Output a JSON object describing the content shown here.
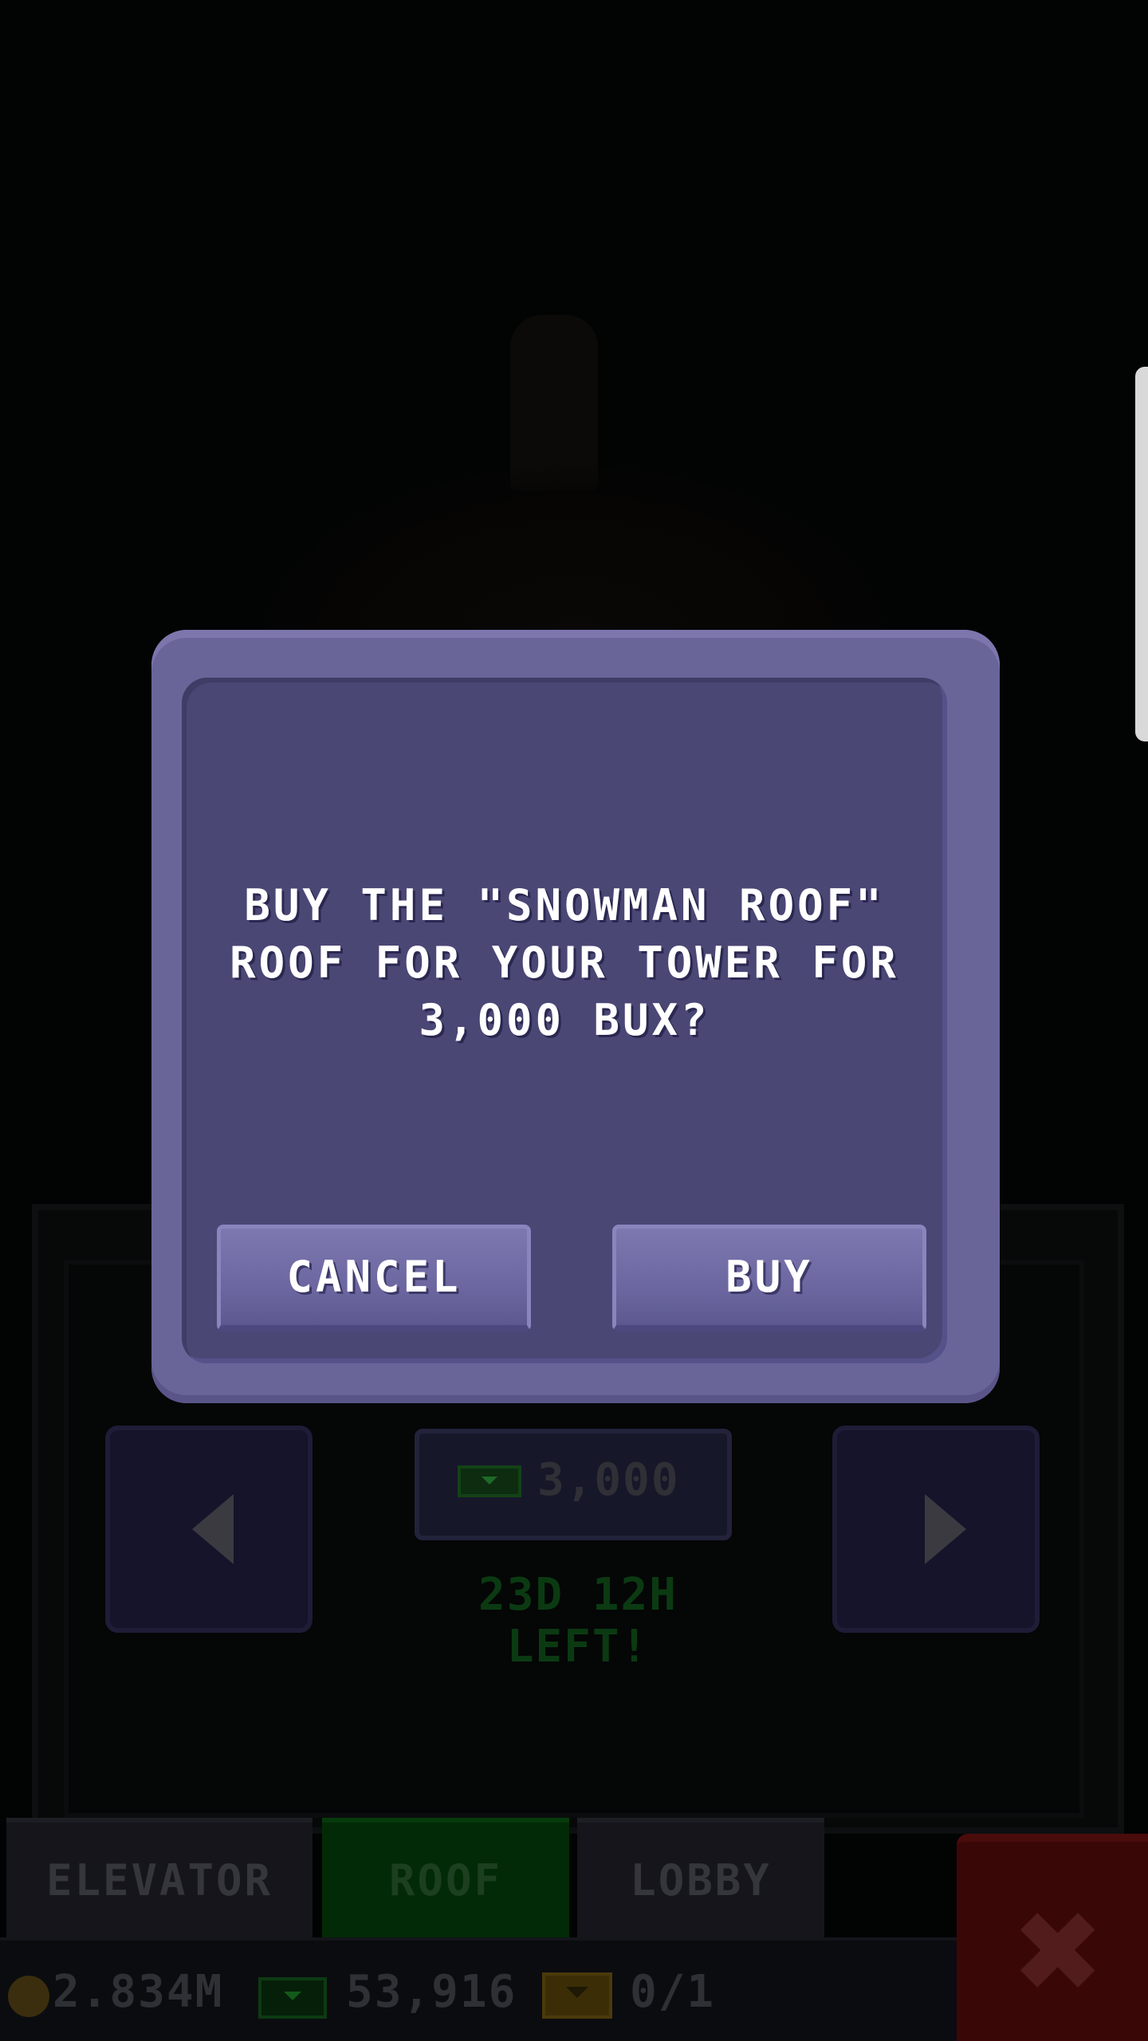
{
  "dialog": {
    "message": "BUY THE \"SNOWMAN ROOF\"\nROOF FOR YOUR TOWER FOR\n3,000 BUX?",
    "cancel_label": "CANCEL",
    "buy_label": "BUY"
  },
  "item": {
    "price": "3,000",
    "time_left": "23D 12H LEFT!"
  },
  "tabs": [
    {
      "label": "ELEVATOR",
      "active": false
    },
    {
      "label": "ROOF",
      "active": true
    },
    {
      "label": "LOBBY",
      "active": false
    }
  ],
  "status": {
    "coins": "2.834M",
    "bux": "53,916",
    "tickets": "0/1"
  },
  "icons": {
    "close": "close-icon",
    "prev": "arrow-left-icon",
    "next": "arrow-right-icon",
    "coin": "coin-icon",
    "bux": "bux-icon",
    "ticket": "ticket-icon"
  },
  "colors": {
    "dialog_frame": "#6a6598",
    "dialog_body": "#4a4775",
    "button": "#6c67a0",
    "active_tab": "#032a06",
    "close": "#3a0707"
  }
}
